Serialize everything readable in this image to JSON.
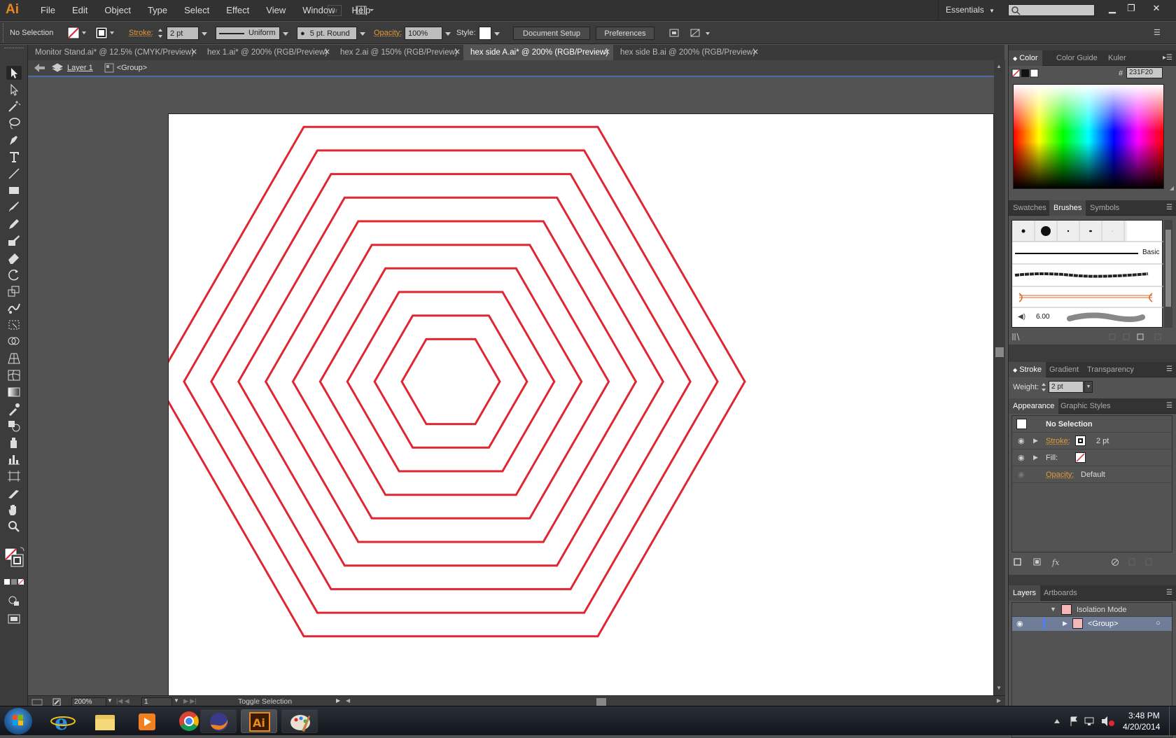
{
  "app": {
    "logo": "Ai",
    "accent": "#e8891c"
  },
  "menubar": {
    "items": [
      "File",
      "Edit",
      "Object",
      "Type",
      "Select",
      "Effect",
      "View",
      "Window",
      "Help"
    ],
    "bridge_label": "Br",
    "workspace": "Essentials"
  },
  "control": {
    "selection": "No Selection",
    "stroke_label": "Stroke:",
    "stroke_weight": "2 pt",
    "profile": "Uniform",
    "brush": "5 pt. Round",
    "opacity_label": "Opacity:",
    "opacity": "100%",
    "style_label": "Style:",
    "doc_setup": "Document Setup",
    "preferences": "Preferences"
  },
  "tabs": [
    {
      "label": "Monitor Stand.ai* @ 12.5% (CMYK/Preview)"
    },
    {
      "label": "hex 1.ai* @ 200% (RGB/Preview)"
    },
    {
      "label": "hex 2.ai @ 150% (RGB/Preview)"
    },
    {
      "label": "hex side A.ai* @ 200% (RGB/Preview)"
    },
    {
      "label": "hex side B.ai @ 200% (RGB/Preview)"
    }
  ],
  "breadcrumb": {
    "layer": "Layer 1",
    "group": "<Group>"
  },
  "artwork": {
    "stroke_color": "#e02630",
    "hexagon_count": 10
  },
  "status": {
    "zoom": "200%",
    "artboard": "1",
    "mode": "Toggle Selection"
  },
  "color_panel": {
    "tabs": [
      "Color",
      "Color Guide",
      "Kuler"
    ],
    "hex_label": "#",
    "hex": "231F20"
  },
  "brushes_panel": {
    "tabs": [
      "Swatches",
      "Brushes",
      "Symbols"
    ],
    "basic_label": "Basic",
    "size_label": "6.00"
  },
  "stroke_panel": {
    "tabs": [
      "Stroke",
      "Gradient",
      "Transparency"
    ],
    "weight_label": "Weight:",
    "weight": "2 pt"
  },
  "appearance_panel": {
    "tabs": [
      "Appearance",
      "Graphic Styles"
    ],
    "title": "No Selection",
    "stroke_label": "Stroke:",
    "stroke_value": "2 pt",
    "fill_label": "Fill:",
    "opacity_label": "Opacity:",
    "opacity_value": "Default"
  },
  "layers_panel": {
    "tabs": [
      "Layers",
      "Artboards"
    ],
    "rows": [
      "Isolation Mode",
      "<Group>"
    ]
  },
  "taskbar": {
    "time": "3:48 PM",
    "date": "4/20/2014"
  }
}
